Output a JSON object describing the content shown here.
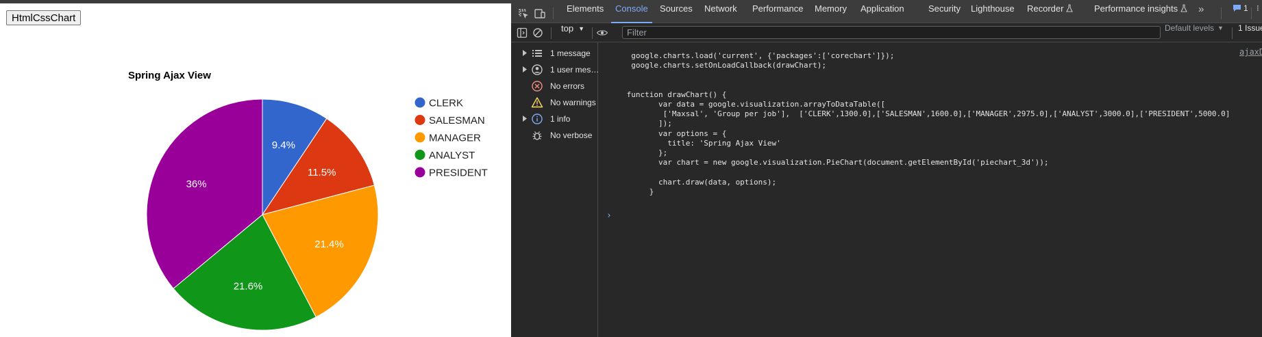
{
  "page": {
    "button_label": "HtmlCssChart"
  },
  "chart_data": {
    "type": "pie",
    "title": "Spring Ajax View",
    "categories": [
      "CLERK",
      "SALESMAN",
      "MANAGER",
      "ANALYST",
      "PRESIDENT"
    ],
    "values": [
      1300,
      1600,
      2975,
      3000,
      5000
    ],
    "slice_labels": [
      "9.4%",
      "11.5%",
      "21.4%",
      "21.6%",
      "36%"
    ],
    "colors": [
      "#3366cc",
      "#dc3912",
      "#ff9900",
      "#109618",
      "#990099"
    ],
    "legend_position": "right"
  },
  "devtools": {
    "tabs": [
      {
        "label": "Elements"
      },
      {
        "label": "Console",
        "active": true
      },
      {
        "label": "Sources"
      },
      {
        "label": "Network"
      },
      {
        "label": "Performance"
      },
      {
        "label": "Memory"
      },
      {
        "label": "Application"
      },
      {
        "label": "Security"
      },
      {
        "label": "Lighthouse"
      },
      {
        "label": "Recorder"
      },
      {
        "label": "Performance insights"
      }
    ],
    "more_tabs": "»",
    "issue_count": "1",
    "tab_cut": "⁝",
    "context": "top",
    "filter_placeholder": "Filter",
    "levels": "Default levels",
    "issues_label": "1 Issue",
    "sidebar": [
      {
        "label": "1 message",
        "icon": "list-icon",
        "expandable": true
      },
      {
        "label": "1 user mes…",
        "icon": "user-icon",
        "expandable": true
      },
      {
        "label": "No errors",
        "icon": "error-icon",
        "expandable": false
      },
      {
        "label": "No warnings",
        "icon": "warning-icon",
        "expandable": false
      },
      {
        "label": "1 info",
        "icon": "info-icon",
        "expandable": true
      },
      {
        "label": "No verbose",
        "icon": "bug-icon",
        "expandable": false
      }
    ],
    "source_link": "ajaxD",
    "code_lines": [
      "  google.charts.load('current', {'packages':['corechart']});",
      "  google.charts.setOnLoadCallback(drawChart);",
      "",
      "",
      " function drawChart() {",
      "        var data = google.visualization.arrayToDataTable([",
      "         ['Maxsal', 'Group per job'],  ['CLERK',1300.0],['SALESMAN',1600.0],['MANAGER',2975.0],['ANALYST',3000.0],['PRESIDENT',5000.0]",
      "        ]);",
      "        var options = {",
      "          title: 'Spring Ajax View'",
      "        };",
      "        var chart = new google.visualization.PieChart(document.getElementById('piechart_3d'));",
      "",
      "        chart.draw(data, options);",
      "      }"
    ],
    "prompt": "›"
  }
}
